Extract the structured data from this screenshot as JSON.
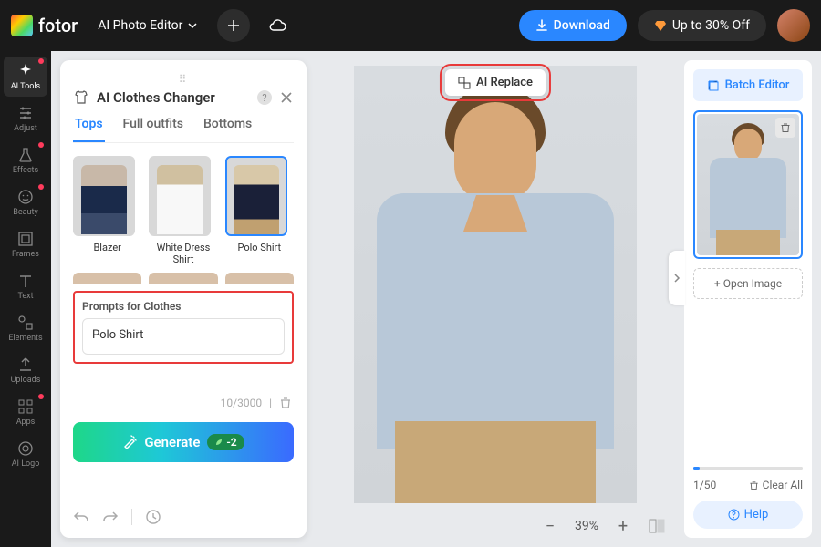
{
  "header": {
    "brand": "fotor",
    "mode": "AI Photo Editor",
    "download": "Download",
    "promo": "Up to 30% Off"
  },
  "toolbar": {
    "items": [
      {
        "label": "AI Tools"
      },
      {
        "label": "Adjust"
      },
      {
        "label": "Effects"
      },
      {
        "label": "Beauty"
      },
      {
        "label": "Frames"
      },
      {
        "label": "Text"
      },
      {
        "label": "Elements"
      },
      {
        "label": "Uploads"
      },
      {
        "label": "Apps"
      },
      {
        "label": "AI Logo"
      }
    ]
  },
  "panel": {
    "title": "AI Clothes Changer",
    "tabs": [
      "Tops",
      "Full outfits",
      "Bottoms"
    ],
    "thumbs": [
      {
        "label": "Blazer"
      },
      {
        "label": "White Dress Shirt"
      },
      {
        "label": "Polo Shirt"
      }
    ],
    "prompt_label": "Prompts for Clothes",
    "prompt_value": "Polo Shirt",
    "char_count": "10/3000",
    "generate": "Generate",
    "credits": "-2"
  },
  "canvas": {
    "badge": "AI Replace",
    "zoom": "39%"
  },
  "right": {
    "batch": "Batch Editor",
    "open": "Open Image",
    "page": "1/50",
    "clear": "Clear All",
    "help": "Help"
  }
}
